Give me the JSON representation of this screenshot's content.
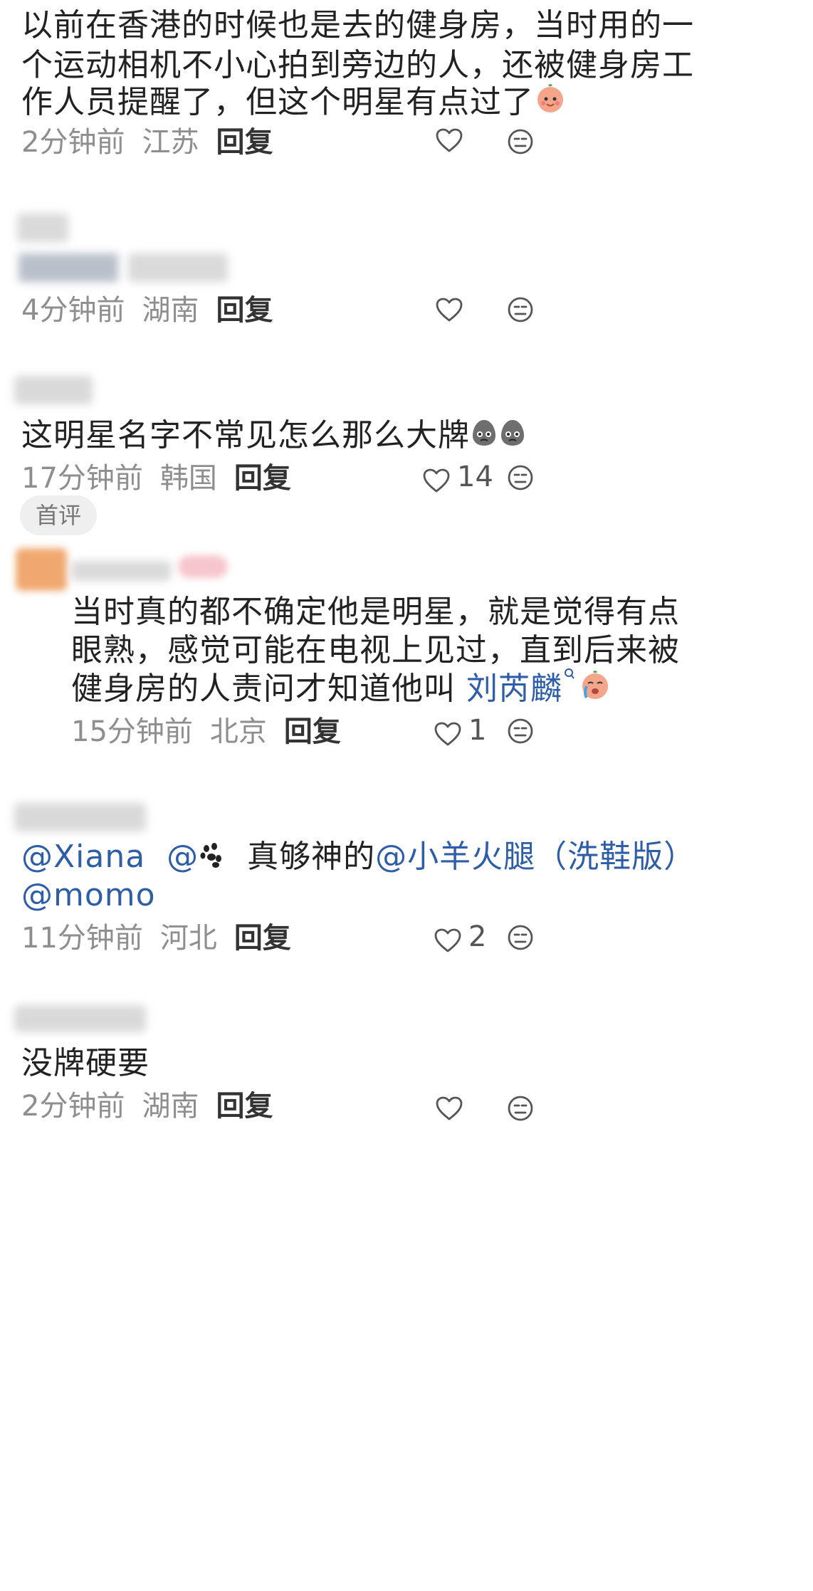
{
  "comments": [
    {
      "text": "以前在香港的时候也是去的健身房，当时用的一个运动相机不小心拍到旁边的人，还被健身房工作人员提醒了，但这个明星有点过了",
      "line1": "以前在香港的时候也是去的健身房，当时用的一",
      "line2": "个运动相机不小心拍到旁边的人，还被健身房工",
      "line3": "作人员提醒了，但这个明星有点过了",
      "time": "2分钟前",
      "location": "江苏",
      "reply": "回复",
      "likes": ""
    },
    {
      "time": "4分钟前",
      "location": "湖南",
      "reply": "回复",
      "likes": ""
    },
    {
      "text": "这明星名字不常见怎么那么大牌",
      "time": "17分钟前",
      "location": "韩国",
      "reply": "回复",
      "likes": "14",
      "badge": "首评"
    },
    {
      "line1": "当时真的都不确定他是明星，就是觉得有点",
      "line2": "眼熟，感觉可能在电视上见过，直到后来被",
      "line3_prefix": "健身房的人责问才知道他叫",
      "line3_link": "刘芮麟",
      "time": "15分钟前",
      "location": "北京",
      "reply": "回复",
      "likes": "1"
    },
    {
      "mention1": "@Xiana",
      "mention2": "@",
      "middle": "真够神的",
      "mention3": "@小羊火腿（洗鞋版）",
      "mention4": "@momo",
      "time": "11分钟前",
      "location": "河北",
      "reply": "回复",
      "likes": "2"
    },
    {
      "text": "没牌硬要",
      "time": "2分钟前",
      "location": "湖南",
      "reply": "回复"
    }
  ],
  "colors": {
    "text": "#222222",
    "meta": "#8e8e8e",
    "mention": "#2f5ea8",
    "icon": "#555555"
  },
  "icons": [
    "heart-icon",
    "dislike-face-icon",
    "search-icon",
    "emoji-icon",
    "paw-icon"
  ]
}
